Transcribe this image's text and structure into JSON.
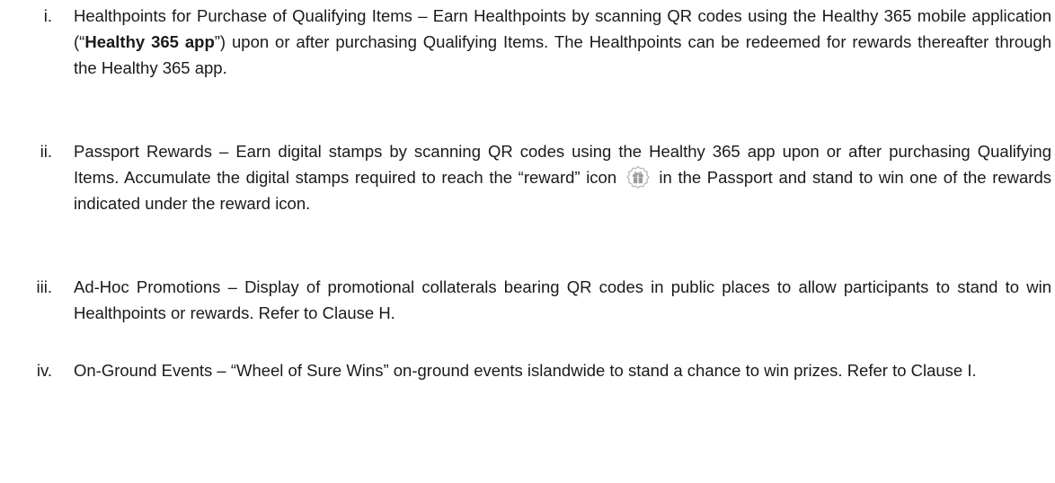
{
  "items": [
    {
      "numeral": "i.",
      "title": "Healthpoints for Purchase of Qualifying Items",
      "text_before_app": " – Earn Healthpoints by scanning QR codes using the Healthy 365 mobile application (“",
      "app_name": "Healthy 365 app",
      "text_after_app": "”) upon or after purchasing Qualifying Items. The Healthpoints can be redeemed for rewards thereafter through the Healthy 365 app."
    },
    {
      "numeral": "ii.",
      "title": "Passport Rewards",
      "text_before_icon": " – Earn digital stamps by scanning QR codes using the Healthy 365 app upon or after purchasing Qualifying Items. Accumulate the digital stamps required to reach the “reward” icon",
      "icon": "gift-icon",
      "text_after_icon": " in the Passport and stand to win one of the rewards indicated under the reward icon."
    },
    {
      "numeral": "iii.",
      "title": "Ad-Hoc Promotions",
      "text": " – Display of promotional collaterals bearing QR codes in public places to allow participants to stand to win Healthpoints or rewards. Refer to Clause H."
    },
    {
      "numeral": "iv.",
      "title": "On-Ground Events",
      "text": " – “Wheel of Sure Wins” on-ground events islandwide to stand a chance to win prizes. Refer to Clause I."
    }
  ],
  "colors": {
    "text": "#1a1a1a",
    "icon_stroke": "#b0b0b0",
    "icon_fill": "#9a9a9a"
  }
}
